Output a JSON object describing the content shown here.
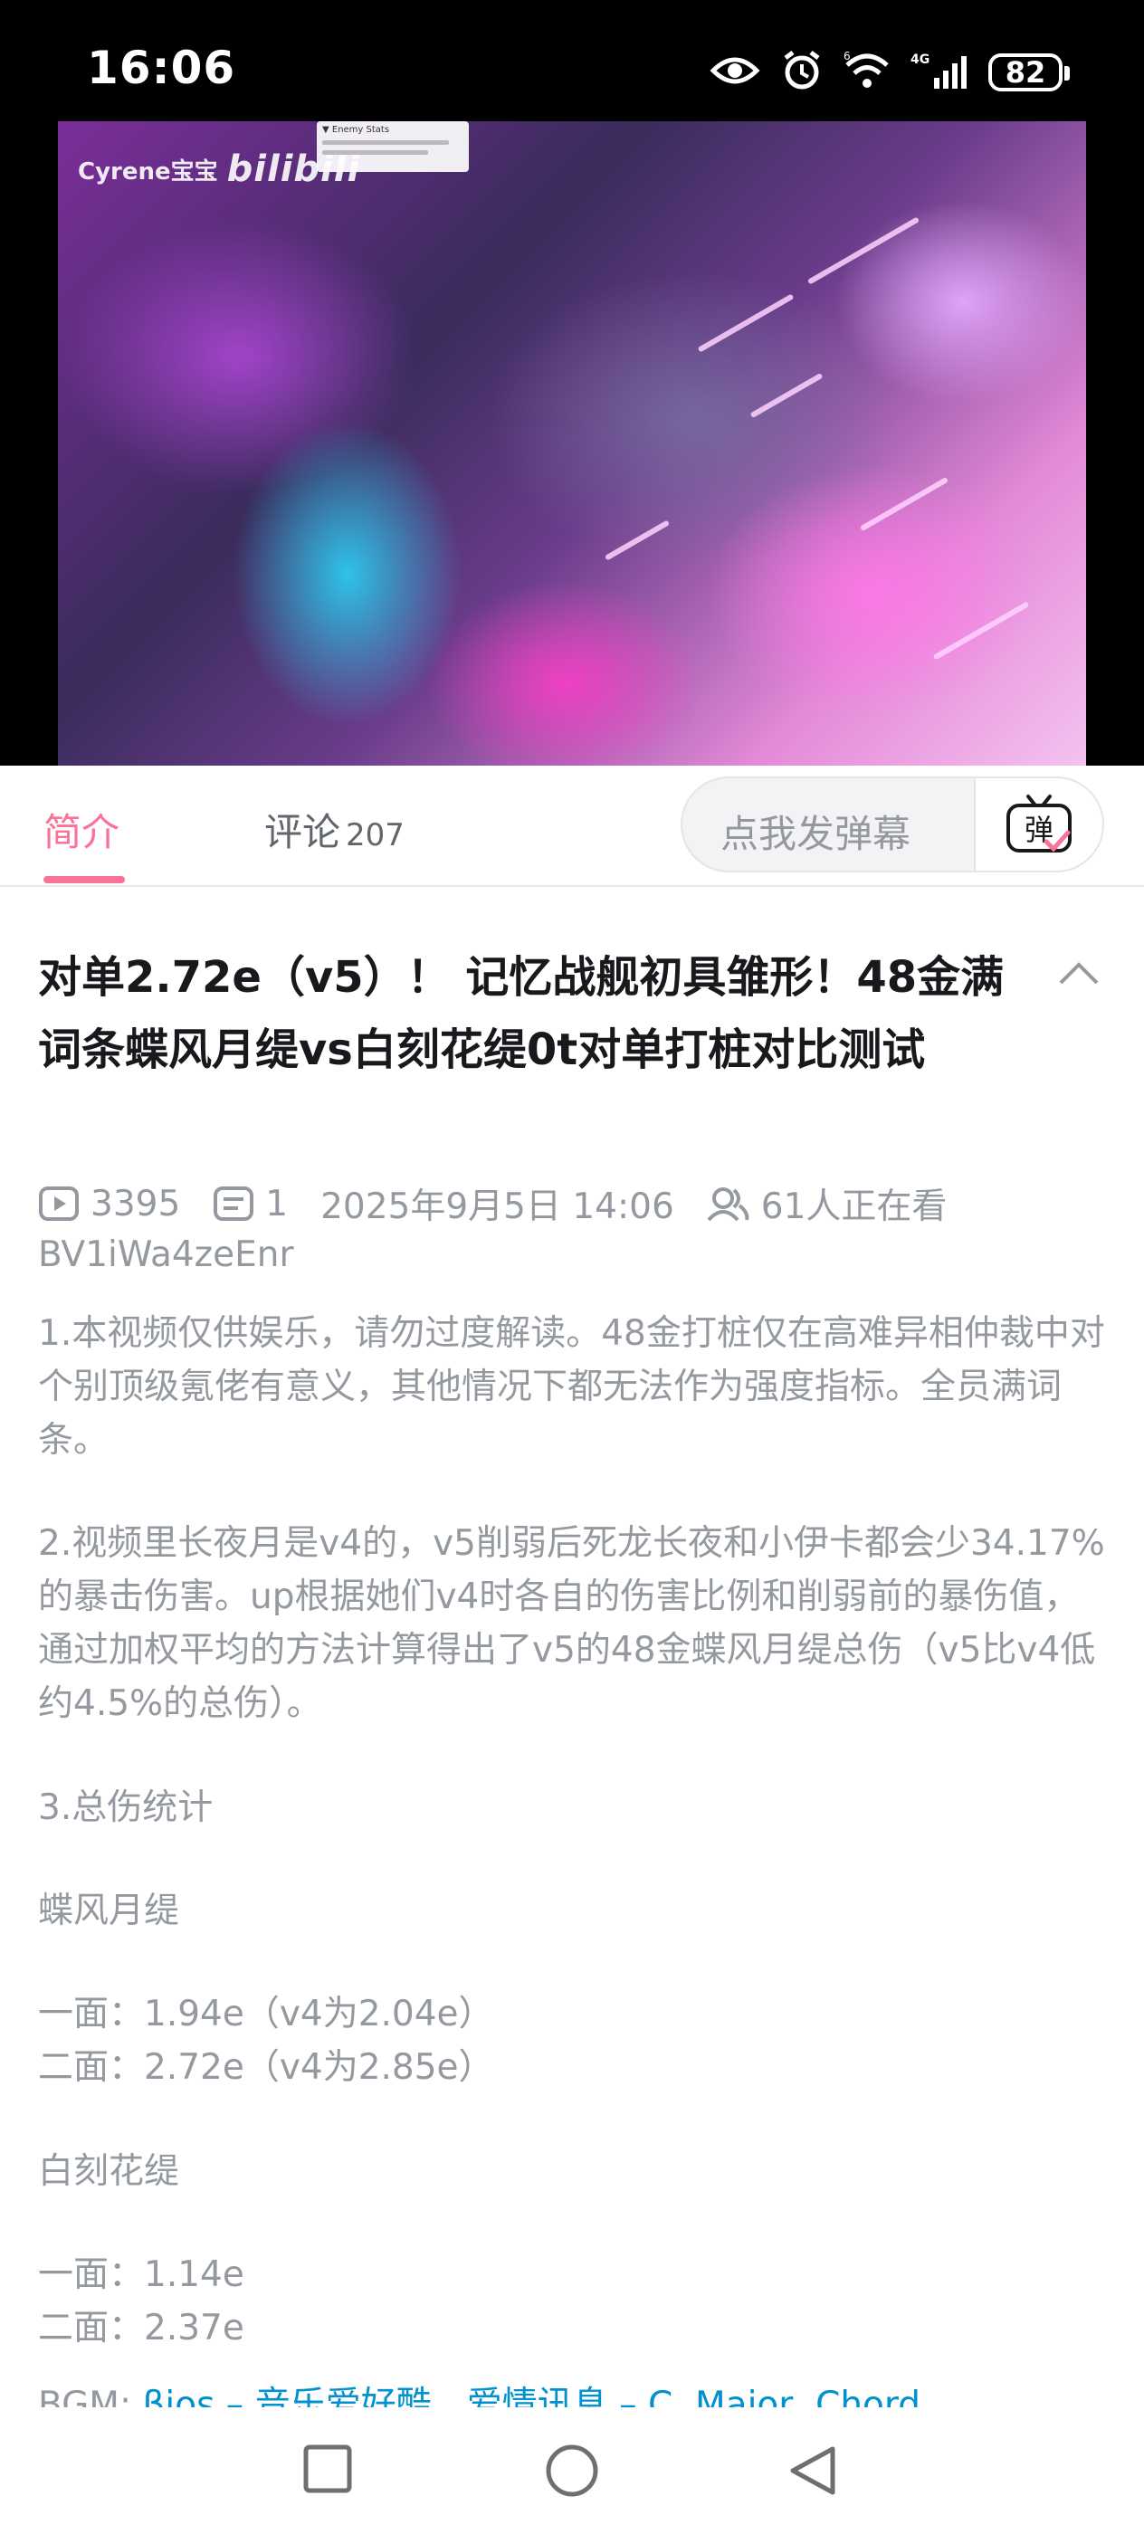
{
  "status_bar": {
    "time": "16:06",
    "battery": "82",
    "icons": [
      "eye-icon",
      "alarm-icon",
      "wifi-icon",
      "signal-4g-icon",
      "battery-icon"
    ]
  },
  "video": {
    "channel_watermark": "Cyrene宝宝",
    "platform_logo": "bilibili",
    "overlay_title": "▼ Enemy Stats"
  },
  "tabs": {
    "intro": "简介",
    "comments": "评论",
    "comments_count": "207"
  },
  "danmaku": {
    "placeholder": "点我发弹幕",
    "button_glyph": "弹"
  },
  "video_info": {
    "title": "对单2.72e（v5）！ 记忆战舰初具雏形！48金满词条蝶风月缇vs白刻花缇0t对单打桩对比测试",
    "views": "3395",
    "danmaku_count": "1",
    "date": "2025年9月5日 14:06",
    "watching": "61人正在看",
    "bvid": "BV1iWa4zeEnr"
  },
  "description": {
    "p1": "1.本视频仅供娱乐，请勿过度解读。48金打桩仅在高难异相仲裁中对个别顶级氪佬有意义，其他情况下都无法作为强度指标。全员满词条。",
    "p2": "2.视频里长夜月是v4的，v5削弱后死龙长夜和小伊卡都会少34.17%的暴击伤害。up根据她们v4时各自的伤害比例和削弱前的暴伤值，通过加权平均的方法计算得出了v5的48金蝶风月缇总伤（v5比v4低约4.5%的总伤）。",
    "p3": "3.总伤统计",
    "team1_name": "蝶风月缇",
    "team1_line1": "一面：1.94e（v4为2.04e）",
    "team1_line2": "二面：2.72e（v4为2.85e）",
    "team2_name": "白刻花缇",
    "team2_line1": "一面：1.14e",
    "team2_line2": "二面：2.37e",
    "bgm_label": "BGM:",
    "bgm_link": "βios – 音乐爱好酷、爱情讯息 – C. Major, Chord"
  },
  "colors": {
    "accent_pink": "#fb7299",
    "text_gray": "#9499a0",
    "link_blue": "#0091ce"
  },
  "nav_bar": {
    "icons": [
      "recents-square-icon",
      "home-circle-icon",
      "back-triangle-icon"
    ]
  }
}
